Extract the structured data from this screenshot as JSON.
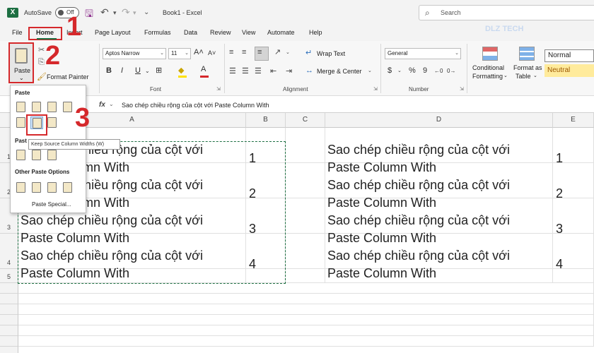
{
  "titlebar": {
    "app_logo": "X",
    "autosave_label": "AutoSave",
    "autosave_state": "Off",
    "document_title": "Book1 - Excel",
    "search_placeholder": "Search",
    "icons": [
      "save-icon",
      "undo-icon",
      "redo-icon",
      "customize-qat-icon",
      "search-icon"
    ]
  },
  "menu": {
    "tabs": [
      "File",
      "Home",
      "Insert",
      "Page Layout",
      "Formulas",
      "Data",
      "Review",
      "View",
      "Automate",
      "Help"
    ],
    "active": "Home"
  },
  "ribbon": {
    "clipboard": {
      "paste_label": "Paste",
      "format_painter_label": "Format Painter"
    },
    "font": {
      "group_label": "Font",
      "font_name": "Aptos Narrow",
      "font_size": "11",
      "bold": "B",
      "italic": "I",
      "underline": "U"
    },
    "alignment": {
      "group_label": "Alignment",
      "wrap_text": "Wrap Text",
      "merge_center": "Merge & Center"
    },
    "number": {
      "group_label": "Number",
      "format": "General",
      "currency": "$",
      "percent": "%",
      "comma": "9"
    },
    "styles": {
      "conditional_formatting_line1": "Conditional",
      "conditional_formatting_line2": "Formatting",
      "format_as_table_line1": "Format as",
      "format_as_table_line2": "Table",
      "normal": "Normal",
      "neutral": "Neutral"
    }
  },
  "watermark": "DLZ TECH",
  "formula_bar": {
    "fx": "fx",
    "content": "Sao chép chiều rộng của cột với Paste Column With"
  },
  "grid": {
    "columns": [
      "A",
      "B",
      "C",
      "D",
      "E"
    ],
    "rows": [
      "1",
      "2",
      "3",
      "4",
      "5"
    ],
    "cell_line1": "Sao chép chiều rộng của cột với",
    "cell_line2": "Paste Column With",
    "values": [
      "1",
      "2",
      "3",
      "4"
    ]
  },
  "paste_menu": {
    "paste_heading": "Paste",
    "paste_values_heading": "Past",
    "other_heading": "Other Paste Options",
    "paste_special": "Paste Special...",
    "tooltip": "Keep Source Column Widths (W)"
  },
  "annotations": {
    "step1": "1",
    "step2": "2",
    "step3": "3"
  },
  "colors": {
    "excel_green": "#1d6f42",
    "annotation_red": "#d5282b",
    "neutral_fill": "#ffeb9c"
  }
}
